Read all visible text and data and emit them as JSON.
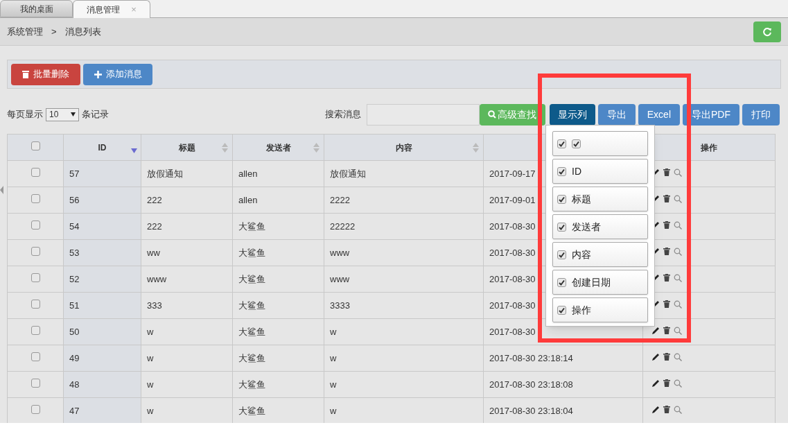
{
  "tabs": [
    {
      "label": "我的桌面",
      "selected": false
    },
    {
      "label": "消息管理",
      "selected": true,
      "close": "×"
    }
  ],
  "breadcrumb": [
    "系统管理",
    ">",
    "消息列表"
  ],
  "toolbar": [
    {
      "label": "批量删除",
      "kind": "danger"
    },
    {
      "label": "添加消息",
      "kind": "primary"
    }
  ],
  "page_size": {
    "prefix": "每页显示",
    "value": "10",
    "suffix": "条记录"
  },
  "search": {
    "label": "搜索消息"
  },
  "actions": [
    {
      "label": "高级查找",
      "kind": "search"
    },
    {
      "label": "显示列",
      "kind": "active"
    },
    {
      "label": "导出",
      "kind": "default"
    },
    {
      "label": "Excel",
      "kind": "default"
    },
    {
      "label": "导出PDF",
      "kind": "default"
    },
    {
      "label": "打印",
      "kind": "default"
    }
  ],
  "table": {
    "header_checked": false,
    "columns": [
      {
        "label": "ID",
        "sorted": true
      },
      {
        "label": "标题",
        "sorted": false
      },
      {
        "label": "发送者",
        "sorted": false
      },
      {
        "label": "内容",
        "sorted": false
      },
      {
        "kind": "plain"
      },
      {
        "label": "操作",
        "kind": "plain"
      }
    ],
    "rows": [
      {
        "checked": false,
        "cells": [
          "57",
          "放假通知",
          "allen",
          "放假通知",
          "2017-09-17"
        ]
      },
      {
        "checked": false,
        "cells": [
          "56",
          "222",
          "allen",
          "2222",
          "2017-09-01"
        ]
      },
      {
        "checked": false,
        "cells": [
          "54",
          "222",
          "大鲨鱼",
          "22222",
          "2017-08-30"
        ]
      },
      {
        "checked": false,
        "cells": [
          "53",
          "ww",
          "大鲨鱼",
          "www",
          "2017-08-30"
        ]
      },
      {
        "checked": false,
        "cells": [
          "52",
          "www",
          "大鲨鱼",
          "www",
          "2017-08-30"
        ]
      },
      {
        "checked": false,
        "cells": [
          "51",
          "333",
          "大鲨鱼",
          "3333",
          "2017-08-30"
        ]
      },
      {
        "checked": false,
        "cells": [
          "50",
          "w",
          "大鲨鱼",
          "w",
          "2017-08-30"
        ]
      },
      {
        "checked": false,
        "cells": [
          "49",
          "w",
          "大鲨鱼",
          "w",
          "2017-08-30 23:18:14"
        ]
      },
      {
        "checked": false,
        "cells": [
          "48",
          "w",
          "大鲨鱼",
          "w",
          "2017-08-30 23:18:08"
        ]
      },
      {
        "checked": false,
        "cells": [
          "47",
          "w",
          "大鲨鱼",
          "w",
          "2017-08-30 23:18:04"
        ]
      }
    ]
  },
  "column_menu": [
    {
      "kind": "checkbox-column",
      "checked": true,
      "inner_checked": true
    },
    {
      "kind": "label",
      "label": "ID",
      "checked": true
    },
    {
      "kind": "label",
      "label": "标题",
      "checked": true
    },
    {
      "kind": "label",
      "label": "发送者",
      "checked": true
    },
    {
      "kind": "label",
      "label": "内容",
      "checked": true
    },
    {
      "kind": "label",
      "label": "创建日期",
      "checked": true
    },
    {
      "kind": "label",
      "label": "操作",
      "checked": true
    }
  ]
}
